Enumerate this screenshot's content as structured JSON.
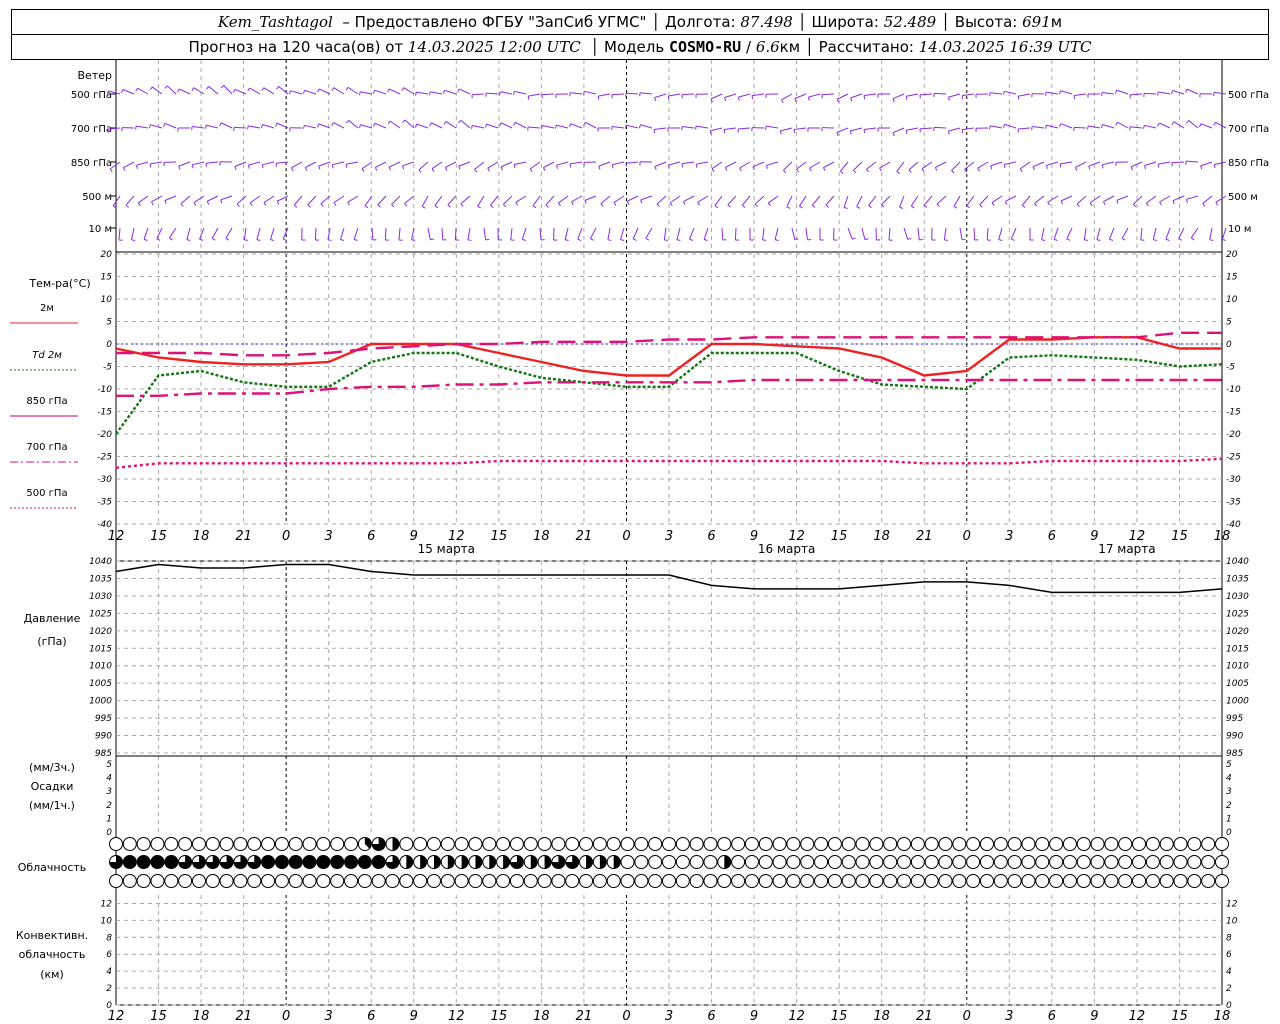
{
  "header": {
    "station": "Kem_Tashtagol",
    "provider": "– Предоставлено ФГБУ \"ЗапСиб УГМС\"",
    "lon_label": "Долгота:",
    "lon_value": "87.498",
    "lat_label": "Широта:",
    "lat_value": "52.489",
    "alt_label": "Высота:",
    "alt_value": "691",
    "alt_unit": "м",
    "forecast_label": "Прогноз на 120 часа(ов) от",
    "forecast_time": "14.03.2025 12:00 UTC",
    "model_label": "Модель",
    "model_name": "COSMO-RU",
    "model_res": "6.6",
    "model_res_unit": "км",
    "computed_label": "Рассчитано:",
    "computed_time": "14.03.2025 16:39 UTC"
  },
  "wind_panel": {
    "title": "Ветер",
    "levels": [
      "500 гПа",
      "700 гПа",
      "850 гПа",
      "500 м",
      "10 м"
    ]
  },
  "time_axis": {
    "hours": [
      "12",
      "15",
      "18",
      "21",
      "0",
      "3",
      "6",
      "9",
      "12",
      "15",
      "18",
      "21",
      "0",
      "3",
      "6",
      "9",
      "12",
      "15",
      "18",
      "21",
      "0",
      "3",
      "6",
      "9",
      "12",
      "15",
      "18"
    ],
    "dates": [
      "15 марта",
      "16 марта",
      "17 марта"
    ]
  },
  "temperature_panel": {
    "title": "Тем-ра(°C)",
    "ticks": [
      "20",
      "15",
      "10",
      "5",
      "0",
      "-5",
      "-10",
      "-15",
      "-20",
      "-25",
      "-30",
      "-35",
      "-40"
    ],
    "legend": [
      {
        "label": "2м",
        "color": "#ee2222",
        "dash": "solid"
      },
      {
        "label": "Td  2м",
        "color": "#117711",
        "dash": "dotted"
      },
      {
        "label": "850 гПа",
        "color": "#cc0077",
        "dash": "solid"
      },
      {
        "label": "700 гПа",
        "color": "#dd1177",
        "dash": "dashdot"
      },
      {
        "label": "500 гПа",
        "color": "#dd1177",
        "dash": "dotted"
      }
    ]
  },
  "pressure_panel": {
    "title": "Давление",
    "unit": "(гПа)",
    "ticks": [
      "1040",
      "1035",
      "1030",
      "1025",
      "1020",
      "1015",
      "1010",
      "1005",
      "1000",
      "995",
      "990",
      "985"
    ]
  },
  "precip_panel": {
    "unit_top": "(мм/3ч.)",
    "title": "Осадки",
    "unit_bottom": "(мм/1ч.)",
    "ticks": [
      "5",
      "4",
      "3",
      "2",
      "1",
      "0"
    ]
  },
  "cloud_panel": {
    "title": "Облачность"
  },
  "convective_panel": {
    "title_line1": "Конвективн.",
    "title_line2": "облачность",
    "unit": "(км)",
    "ticks": [
      "12",
      "10",
      "8",
      "6",
      "4",
      "2",
      "0"
    ]
  },
  "chart_data": {
    "type": "line",
    "x_hours_from_start": [
      0,
      3,
      6,
      9,
      12,
      15,
      18,
      21,
      24,
      27,
      30,
      33,
      36,
      39,
      42,
      45,
      48,
      51,
      54,
      57,
      60,
      63,
      66,
      69,
      72,
      75,
      78
    ],
    "series": [
      {
        "name": "2м",
        "color": "#ee2222",
        "values": [
          -1,
          -3,
          -4,
          -4.5,
          -4.5,
          -4,
          0,
          0,
          0,
          -2,
          -4,
          -6,
          -7,
          -7,
          0,
          0,
          -0.5,
          -1,
          -3,
          -7,
          -6,
          1,
          1,
          1.5,
          1.5,
          -1,
          -1
        ]
      },
      {
        "name": "Td  2м",
        "color": "#117711",
        "values": [
          -20,
          -7,
          -6,
          -8.5,
          -9.5,
          -9.5,
          -4,
          -2,
          -2,
          -5,
          -7.5,
          -8.5,
          -9.5,
          -9.5,
          -2,
          -2,
          -2,
          -6,
          -9,
          -9.5,
          -10,
          -3,
          -2.5,
          -3,
          -3.5,
          -5,
          -4.5
        ]
      },
      {
        "name": "850 гПа",
        "color": "#cc0077",
        "values": [
          -2,
          -2,
          -2,
          -2.5,
          -2.5,
          -2,
          -1,
          -0.5,
          0,
          0,
          0.5,
          0.5,
          0.5,
          1,
          1,
          1.5,
          1.5,
          1.5,
          1.5,
          1.5,
          1.5,
          1.5,
          1.5,
          1.5,
          1.5,
          2.5,
          2.5
        ]
      },
      {
        "name": "700 гПа",
        "color": "#dd1177",
        "values": [
          -11.5,
          -11.5,
          -11,
          -11,
          -11,
          -10,
          -9.5,
          -9.5,
          -9,
          -9,
          -8.5,
          -8.5,
          -8.5,
          -8.5,
          -8.5,
          -8,
          -8,
          -8,
          -8,
          -8,
          -8,
          -8,
          -8,
          -8,
          -8,
          -8,
          -8
        ]
      },
      {
        "name": "500 гПа",
        "color": "#dd1177",
        "values": [
          -27.5,
          -26.5,
          -26.5,
          -26.5,
          -26.5,
          -26.5,
          -26.5,
          -26.5,
          -26.5,
          -26,
          -26,
          -26,
          -26,
          -26,
          -26,
          -26,
          -26,
          -26,
          -26,
          -26.5,
          -26.5,
          -26.5,
          -26,
          -26,
          -26,
          -26,
          -25.5
        ]
      },
      {
        "name": "Давление",
        "color": "#000000",
        "values": [
          1037,
          1039,
          1038,
          1038,
          1039,
          1039,
          1037,
          1036,
          1036,
          1036,
          1036,
          1036,
          1036,
          1036,
          1033,
          1032,
          1032,
          1032,
          1033,
          1034,
          1034,
          1033,
          1031,
          1031,
          1031,
          1031,
          1032
        ]
      }
    ],
    "temp_ylim": [
      -40,
      20
    ],
    "pressure_ylim": [
      985,
      1040
    ],
    "precip_ylim": [
      0,
      5
    ],
    "convective_ylim": [
      0,
      13
    ],
    "precipitation_mm": [
      0,
      0,
      0,
      0,
      0,
      0,
      0,
      0,
      0,
      0,
      0,
      0,
      0,
      0,
      0,
      0,
      0,
      0,
      0,
      0,
      0,
      0,
      0,
      0,
      0,
      0,
      0
    ],
    "cloud_cover_high_eighths": [
      0,
      0,
      0,
      0,
      0,
      0,
      0,
      0,
      0,
      0,
      0,
      0,
      0,
      0,
      0,
      0,
      0,
      0,
      0,
      0,
      0,
      0,
      0,
      0,
      0,
      0,
      0,
      0,
      0,
      0,
      0,
      0,
      0,
      0,
      0,
      0,
      0,
      0,
      0,
      0,
      0,
      0,
      0,
      0,
      0,
      0,
      0,
      0,
      0,
      0,
      0,
      0,
      0,
      0,
      0,
      0,
      0,
      0,
      0,
      0,
      0,
      0,
      0,
      0,
      0,
      0,
      0,
      0,
      0,
      0,
      0,
      0,
      0,
      0,
      0,
      0,
      0,
      0,
      0,
      0,
      0
    ],
    "cloud_cover_mid_eighths": [
      0,
      0,
      0,
      0,
      0,
      0,
      0,
      0,
      0,
      0,
      0,
      0,
      0,
      0,
      0,
      0,
      0,
      0,
      3,
      6,
      4,
      0,
      0,
      0,
      0,
      0,
      0,
      0,
      0,
      0,
      0,
      0,
      0,
      0,
      0,
      0,
      0,
      0,
      0,
      0,
      0,
      0,
      0,
      0,
      0,
      0,
      0,
      0,
      0,
      0,
      0,
      0,
      0,
      0,
      0,
      0,
      0,
      0,
      0,
      0,
      0,
      0,
      0,
      0,
      0,
      0,
      0,
      0,
      0,
      0,
      0,
      0,
      0,
      0,
      0,
      0,
      0,
      0,
      0,
      0,
      0
    ],
    "cloud_cover_low_eighths": [
      6,
      8,
      8,
      8,
      8,
      6,
      6,
      6,
      6,
      6,
      6,
      8,
      8,
      8,
      8,
      8,
      8,
      8,
      8,
      8,
      6,
      4,
      4,
      4,
      4,
      4,
      4,
      4,
      4,
      6,
      4,
      4,
      6,
      6,
      4,
      4,
      4,
      0,
      0,
      0,
      0,
      0,
      0,
      0,
      4,
      0,
      0,
      0,
      0,
      0,
      0,
      0,
      0,
      0,
      0,
      0,
      0,
      0,
      0,
      0,
      0,
      0,
      0,
      0,
      0,
      0,
      0,
      0,
      0,
      0,
      0,
      0,
      0,
      0,
      0,
      0,
      0,
      0,
      0,
      0,
      0
    ],
    "cloud_cover_extra_eighths": [
      0,
      0,
      0,
      0,
      0,
      0,
      0,
      0,
      0,
      0,
      0,
      0,
      0,
      0,
      0,
      0,
      0,
      0,
      0,
      0,
      0,
      0,
      0,
      0,
      0,
      0,
      0,
      0,
      0,
      0,
      0,
      0,
      0,
      0,
      0,
      0,
      0,
      0,
      0,
      0,
      0,
      0,
      0,
      0,
      0,
      0,
      0,
      0,
      0,
      0,
      0,
      0,
      0,
      0,
      0,
      0,
      0,
      0,
      0,
      0,
      0,
      0,
      0,
      0,
      0,
      0,
      0,
      0,
      0,
      0,
      0,
      0,
      0,
      0,
      0,
      0,
      0,
      0,
      0,
      0,
      0
    ],
    "wind_direction_deg": {
      "500_hPa": [
        300,
        300,
        305,
        305,
        300,
        295,
        290,
        290,
        285,
        280,
        275,
        270,
        270,
        265,
        260,
        255,
        250,
        255,
        260,
        265,
        270,
        270,
        275,
        275,
        280,
        280,
        280
      ],
      "700_hPa": [
        280,
        280,
        280,
        285,
        285,
        290,
        295,
        300,
        300,
        295,
        290,
        285,
        280,
        275,
        270,
        265,
        265,
        260,
        260,
        265,
        270,
        275,
        280,
        285,
        290,
        295,
        300
      ],
      "850_hPa": [
        250,
        255,
        260,
        260,
        255,
        250,
        245,
        240,
        240,
        245,
        250,
        255,
        260,
        260,
        250,
        240,
        235,
        230,
        230,
        235,
        240,
        245,
        250,
        255,
        260,
        260,
        260
      ],
      "500_m": [
        230,
        235,
        240,
        240,
        235,
        230,
        225,
        220,
        220,
        225,
        230,
        235,
        240,
        240,
        230,
        220,
        215,
        210,
        215,
        220,
        225,
        230,
        235,
        240,
        240,
        240,
        240
      ],
      "10_m": [
        200,
        200,
        205,
        200,
        195,
        190,
        185,
        180,
        180,
        185,
        190,
        195,
        200,
        200,
        190,
        180,
        175,
        170,
        175,
        180,
        185,
        190,
        195,
        200,
        200,
        200,
        200
      ]
    }
  }
}
